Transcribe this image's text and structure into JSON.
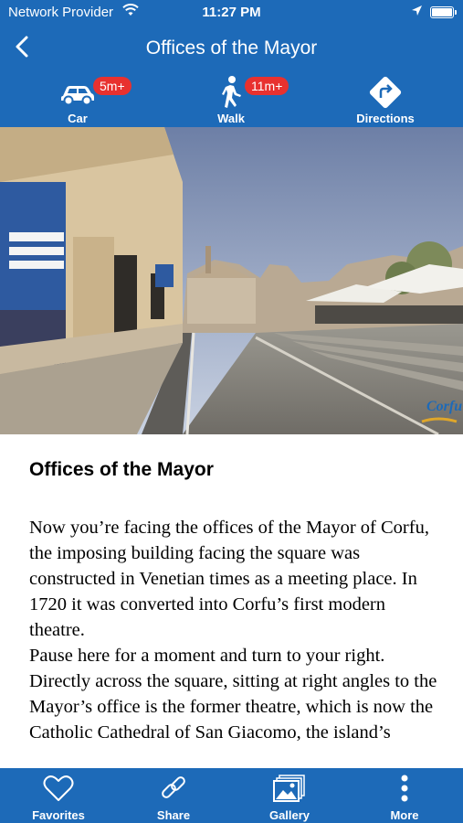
{
  "status_bar": {
    "carrier": "Network Provider",
    "time": "11:27 PM",
    "icons": [
      "wifi-icon",
      "location-arrow-icon",
      "battery-icon"
    ]
  },
  "nav": {
    "title": "Offices of the Mayor",
    "back_icon": "chevron-left-icon"
  },
  "modes": [
    {
      "label": "Car",
      "badge": "5m+",
      "icon": "car-icon"
    },
    {
      "label": "Walk",
      "badge": "11m+",
      "icon": "walking-person-icon"
    },
    {
      "label": "Directions",
      "icon": "directions-sign-icon"
    }
  ],
  "hero": {
    "watermark": "Corfu"
  },
  "article": {
    "heading": "Offices of the Mayor",
    "paragraph_1": "Now you’re facing the offices of the Mayor of Corfu, the imposing building facing the square was constructed in Venetian times as a meeting place. In 1720 it was converted into Corfu’s first modern theatre.",
    "paragraph_2": "Pause here for a moment and turn to your right. Directly across the square, sitting at right angles to the Mayor’s office is the former theatre, which is now the Catholic Cathedral of San Giacomo, the island’s"
  },
  "tabs": [
    {
      "label": "Favorites",
      "icon": "heart-icon"
    },
    {
      "label": "Share",
      "icon": "link-icon"
    },
    {
      "label": "Gallery",
      "icon": "gallery-icon"
    },
    {
      "label": "More",
      "icon": "more-vertical-icon"
    }
  ],
  "colors": {
    "brand_blue": "#1d6ab8",
    "badge_red": "#e8312f"
  }
}
